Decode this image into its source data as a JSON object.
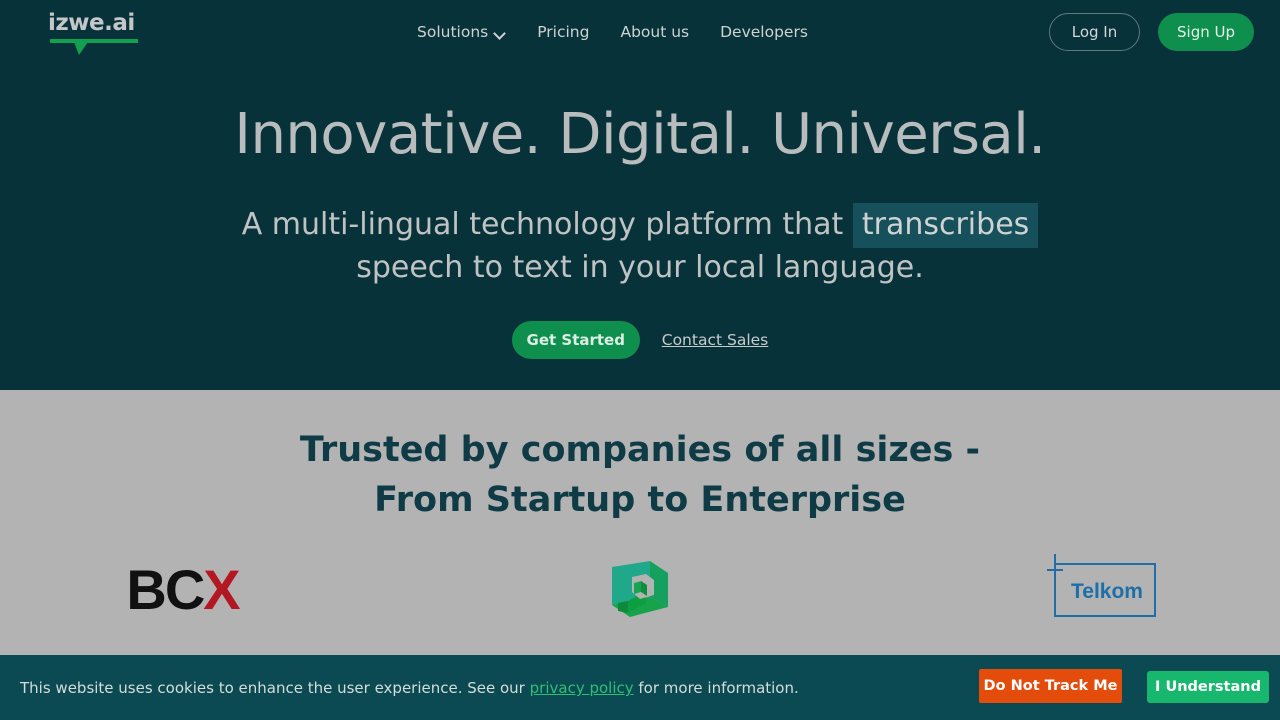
{
  "theme": {
    "hero_bg": "#083239",
    "section_bg": "#b3b3b3",
    "banner_bg": "#0b4a52",
    "green": "#0e8f4e",
    "bright_green": "#17b86e",
    "orange": "#e44c0c",
    "highlight_teal": "#16505a",
    "heading_light": "#b9bcbc",
    "heading_dark": "#0e3b45",
    "telkom_blue": "#1e6fa8",
    "bcx_red": "#b31722"
  },
  "nav": {
    "logo_text": "izwe.ai",
    "logo_icon": "speech-bubble-underline-icon",
    "links": [
      {
        "label": "Solutions",
        "icon": "chevron-down-icon",
        "has_dropdown": true
      },
      {
        "label": "Pricing",
        "has_dropdown": false
      },
      {
        "label": "About us",
        "has_dropdown": false
      },
      {
        "label": "Developers",
        "has_dropdown": false
      }
    ],
    "login_label": "Log In",
    "signup_label": "Sign Up"
  },
  "hero": {
    "title": "Innovative. Digital. Universal.",
    "subtitle_part1": "A multi-lingual technology platform that",
    "subtitle_highlight": "transcribes",
    "subtitle_part2": "speech to text in your local language.",
    "cta_primary": "Get Started",
    "cta_secondary": "Contact Sales"
  },
  "trusted": {
    "title_line1": "Trusted by companies of all sizes -",
    "title_line2": "From Startup to Enterprise",
    "logos": [
      {
        "name": "BCX",
        "icon": "bcx-logo",
        "text_black": "BC",
        "text_red": "X",
        "text_tail": ""
      },
      {
        "name": "cube",
        "icon": "isometric-cube-logo"
      },
      {
        "name": "Telkom",
        "icon": "telkom-logo",
        "label": "Telkom"
      }
    ]
  },
  "cookie": {
    "text_before": "This website uses cookies to enhance the user experience. See our",
    "link_label": "privacy policy",
    "text_after": "for more information.",
    "reject_label": "Do Not Track Me",
    "accept_label": "I Understand"
  }
}
